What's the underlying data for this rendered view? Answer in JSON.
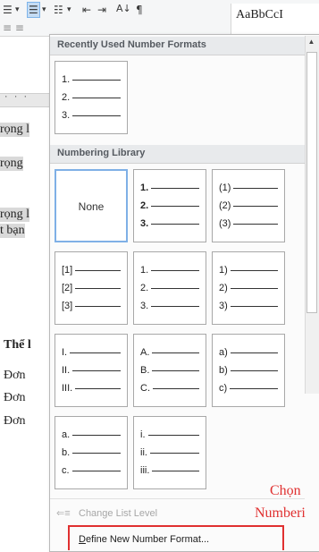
{
  "ribbon": {
    "icons": [
      {
        "name": "bullets-icon",
        "glyph": "☰",
        "label": "▾"
      },
      {
        "name": "numbering-icon",
        "glyph": "☰",
        "label": "▾"
      },
      {
        "name": "multilevel-list-icon",
        "glyph": "☷",
        "label": "▾"
      },
      {
        "name": "decrease-indent-icon",
        "glyph": "⇤"
      },
      {
        "name": "increase-indent-icon",
        "glyph": "⇥"
      },
      {
        "name": "sort-icon",
        "glyph": "A↓"
      },
      {
        "name": "pilcrow-icon",
        "glyph": "¶"
      }
    ],
    "styles_preview": "AaBbCcI",
    "second_row_glyph": "≡ ≡"
  },
  "document": {
    "lines": [
      "rọng l",
      "rọng",
      "rọng l",
      "t bạn"
    ],
    "bold_line": "Thể l",
    "unit_lines": [
      "Đơn",
      "Đơn",
      "Đơn"
    ]
  },
  "gallery": {
    "recent_title": "Recently Used Number Formats",
    "library_title": "Numbering Library",
    "recent_tile": {
      "marks": [
        "1.",
        "2.",
        "3."
      ]
    },
    "library_tiles": [
      {
        "none": "None"
      },
      {
        "marks": [
          "1.",
          "2.",
          "3."
        ],
        "bold": true
      },
      {
        "marks": [
          "(1)",
          "(2)",
          "(3)"
        ]
      },
      {
        "marks": [
          "[1]",
          "[2]",
          "[3]"
        ]
      },
      {
        "marks": [
          "1.",
          "2.",
          "3."
        ]
      },
      {
        "marks": [
          "1)",
          "2)",
          "3)"
        ]
      },
      {
        "marks": [
          "I.",
          "II.",
          "III."
        ]
      },
      {
        "marks": [
          "A.",
          "B.",
          "C."
        ]
      },
      {
        "marks": [
          "a)",
          "b)",
          "c)"
        ]
      },
      {
        "marks": [
          "a.",
          "b.",
          "c."
        ]
      },
      {
        "marks": [
          "i.",
          "ii.",
          "iii."
        ]
      }
    ],
    "menu": {
      "change_level": "Change List Level",
      "define_prefix": "D",
      "define_rest": "efine New Number Format..."
    }
  },
  "annotation": {
    "line1": "Chọn",
    "line2": "Numberi",
    "color": "#e03030"
  }
}
